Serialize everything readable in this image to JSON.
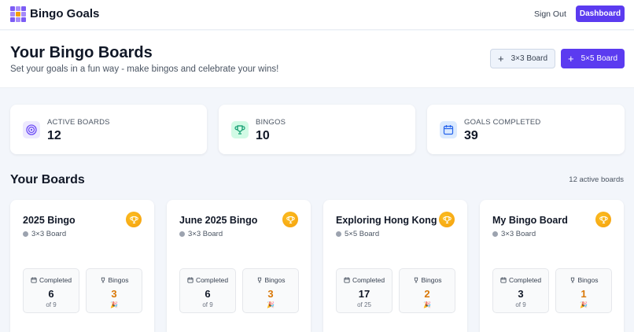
{
  "app": {
    "title": "Bingo Goals"
  },
  "nav": {
    "signout_label": "Sign Out",
    "dashboard_label": "Dashboard"
  },
  "header": {
    "title": "Your Bingo Boards",
    "subtitle": "Set your goals in a fun way - make bingos and celebrate your wins!",
    "btn_3x3": "3×3 Board",
    "btn_5x5": "5×5 Board"
  },
  "stats": [
    {
      "label": "ACTIVE BOARDS",
      "value": "12",
      "icon": "target-icon"
    },
    {
      "label": "BINGOS",
      "value": "10",
      "icon": "trophy-icon"
    },
    {
      "label": "GOALS COMPLETED",
      "value": "39",
      "icon": "calendar-icon"
    }
  ],
  "boards_section": {
    "title": "Your Boards",
    "count": "12 active boards"
  },
  "boards": [
    {
      "title": "2025 Bingo",
      "size": "3×3 Board",
      "completed_label": "Completed",
      "completed": "6",
      "total": "of 9",
      "bingos_label": "Bingos",
      "bingos": "3",
      "emoji": "🎉"
    },
    {
      "title": "June 2025 Bingo",
      "size": "3×3 Board",
      "completed_label": "Completed",
      "completed": "6",
      "total": "of 9",
      "bingos_label": "Bingos",
      "bingos": "3",
      "emoji": "🎉"
    },
    {
      "title": "Exploring Hong Kong",
      "size": "5×5 Board",
      "completed_label": "Completed",
      "completed": "17",
      "total": "of 25",
      "bingos_label": "Bingos",
      "bingos": "2",
      "emoji": "🎉"
    },
    {
      "title": "My Bingo Board",
      "size": "3×3 Board",
      "completed_label": "Completed",
      "completed": "3",
      "total": "of 9",
      "bingos_label": "Bingos",
      "bingos": "1",
      "emoji": "🎉"
    }
  ],
  "colors": {
    "accent": "#5b3bf0",
    "gold": "#d97706",
    "background": "#f3f6fb"
  }
}
